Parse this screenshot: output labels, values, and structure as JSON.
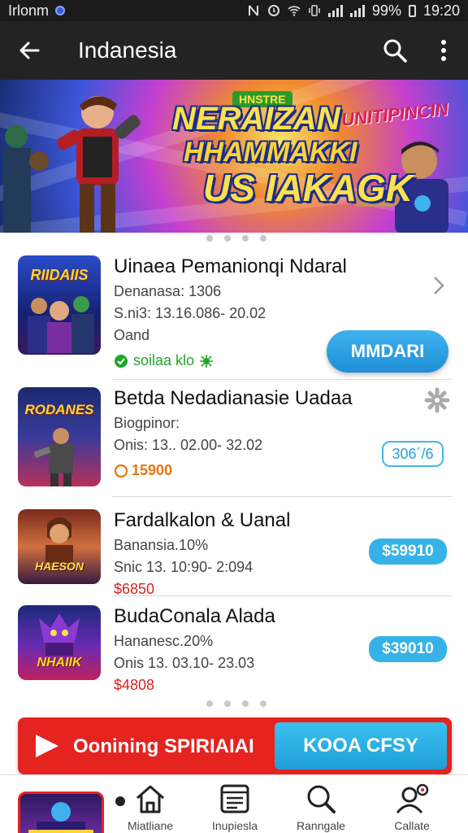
{
  "status_bar": {
    "carrier": "Irlonm",
    "battery": "99%",
    "time": "19:20"
  },
  "app_bar": {
    "title": "Indanesia",
    "back_icon": "arrow-left-icon",
    "search_icon": "search-icon",
    "more_icon": "more-vert-icon"
  },
  "banner": {
    "line1": "NERAIZAN",
    "line2": "HHAMMAKKI",
    "line3": "US IAKAGK",
    "tag": "UNITIPINCIN",
    "badge": "HNSTRE"
  },
  "list": [
    {
      "name": "Uinaea Pemanionqi Ndaral",
      "line1": "Denanasa: 1306",
      "line2": "S.ni3: 13.16.086- 20.02",
      "line3": "Oand",
      "extra": "soilaa klo",
      "button": "MMDARI",
      "thumb_text": "RIIDAIIS"
    },
    {
      "name": "Betda Nedadianasie Uadaa",
      "line1": "Biogpinor:",
      "line2": "Onis: 13.. 02.00- 32.02",
      "price": "15900",
      "button": "306´/6",
      "thumb_text": "RODANES"
    },
    {
      "name": "Fardalkalon & Uanal",
      "line1": "Banansia.10%",
      "line2": "Snic 13. 10:90- 2:094",
      "price": "$6850",
      "button": "$59910",
      "thumb_text": "HAESON"
    },
    {
      "name": "BudaConala Alada",
      "line1": "Hananesc.20%",
      "line2": "Onis 13. 03.10- 23.03",
      "price": "$4808",
      "button": "$39010",
      "thumb_text": "NHAIIK"
    }
  ],
  "promo": {
    "text": "Oonining SPIRIAIAI",
    "button": "KOOA CFSY"
  },
  "bottom_nav": [
    {
      "label": "Miatliane",
      "icon": "home-icon"
    },
    {
      "label": "Inupiesla",
      "icon": "list-icon"
    },
    {
      "label": "Ranngale",
      "icon": "search-icon"
    },
    {
      "label": "Callate",
      "icon": "profile-icon"
    }
  ],
  "colors": {
    "accent": "#1f8fd6",
    "promo": "#e5231f",
    "extra_green": "#22a52a",
    "price_red": "#d8231f",
    "price_orange": "#e8770e"
  }
}
